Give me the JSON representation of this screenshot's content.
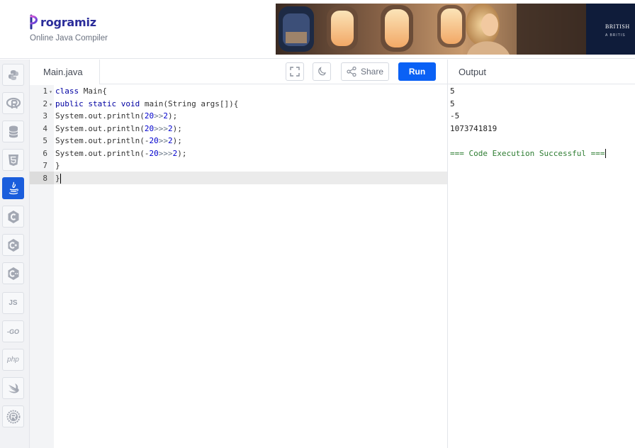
{
  "header": {
    "logo_text": "rogramiz",
    "subtitle": "Online Java Compiler",
    "ad": {
      "brand": "BRITISH",
      "tagline": "A BRITIS"
    }
  },
  "sidebar": {
    "items": [
      {
        "name": "python",
        "label": ""
      },
      {
        "name": "r",
        "label": ""
      },
      {
        "name": "sql",
        "label": ""
      },
      {
        "name": "html",
        "label": ""
      },
      {
        "name": "java",
        "label": "",
        "active": true
      },
      {
        "name": "c",
        "label": ""
      },
      {
        "name": "csharp",
        "label": ""
      },
      {
        "name": "cpp",
        "label": ""
      },
      {
        "name": "javascript",
        "label": "JS"
      },
      {
        "name": "go",
        "label": "-GO"
      },
      {
        "name": "php",
        "label": "php"
      },
      {
        "name": "swift",
        "label": ""
      },
      {
        "name": "rust",
        "label": ""
      }
    ]
  },
  "toolbar": {
    "file_name": "Main.java",
    "share_label": "Share",
    "run_label": "Run"
  },
  "editor": {
    "line_numbers": [
      "1",
      "2",
      "3",
      "4",
      "5",
      "6",
      "7",
      "8"
    ],
    "lines": [
      "class Main{",
      "public static void main(String args[]){",
      "System.out.println(20>>2);",
      "System.out.println(20>>>2);",
      "System.out.println(-20>>2);",
      "System.out.println(-20>>>2);",
      "}",
      "}"
    ]
  },
  "output": {
    "title": "Output",
    "lines": [
      "5",
      "5",
      "-5",
      "1073741819",
      "",
      "=== Code Execution Successful ==="
    ]
  },
  "colors": {
    "accent": "#0a61f5",
    "sidebar_active": "#1a5ddc",
    "logo": "#2b2d9a",
    "keyword": "#0000a2",
    "success": "#2e7d32"
  }
}
